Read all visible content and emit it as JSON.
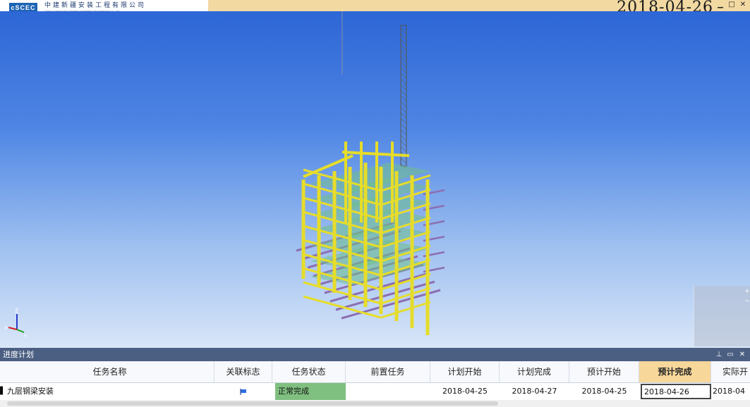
{
  "header": {
    "logo_mark": "cSCEC",
    "company_name": "中建新疆安装工程有限公司",
    "company_en": "China Construction Xinjiang Installation Engineering Co.,Ltd",
    "date": "2018-04-26"
  },
  "panel": {
    "title": "进度计划",
    "columns": [
      "任务名称",
      "关联标志",
      "任务状态",
      "前置任务",
      "计划开始",
      "计划完成",
      "预计开始",
      "预计完成",
      "实际开"
    ],
    "rows": [
      {
        "name": "九层钢梁安装",
        "flag_icon": "flag-icon",
        "status": "正常完成",
        "predecessor": "",
        "plan_start": "2018-04-25",
        "plan_end": "2018-04-27",
        "est_start": "2018-04-25",
        "est_end": "2018-04-26",
        "actual_start": "2018-04"
      }
    ]
  },
  "colors": {
    "topbar": "#f2d9a2",
    "panel_header": "#4b5f82",
    "status_green": "#7fbf7f",
    "highlight_header": "#f7d79a",
    "steel_yellow": "#e6dc2a",
    "beam_purple": "#8b6fb3",
    "slab_green": "#6fbf8a"
  },
  "viewport": {
    "axis_labels": [
      "Z",
      "X",
      "Y"
    ],
    "model": "steel-structure-building"
  }
}
